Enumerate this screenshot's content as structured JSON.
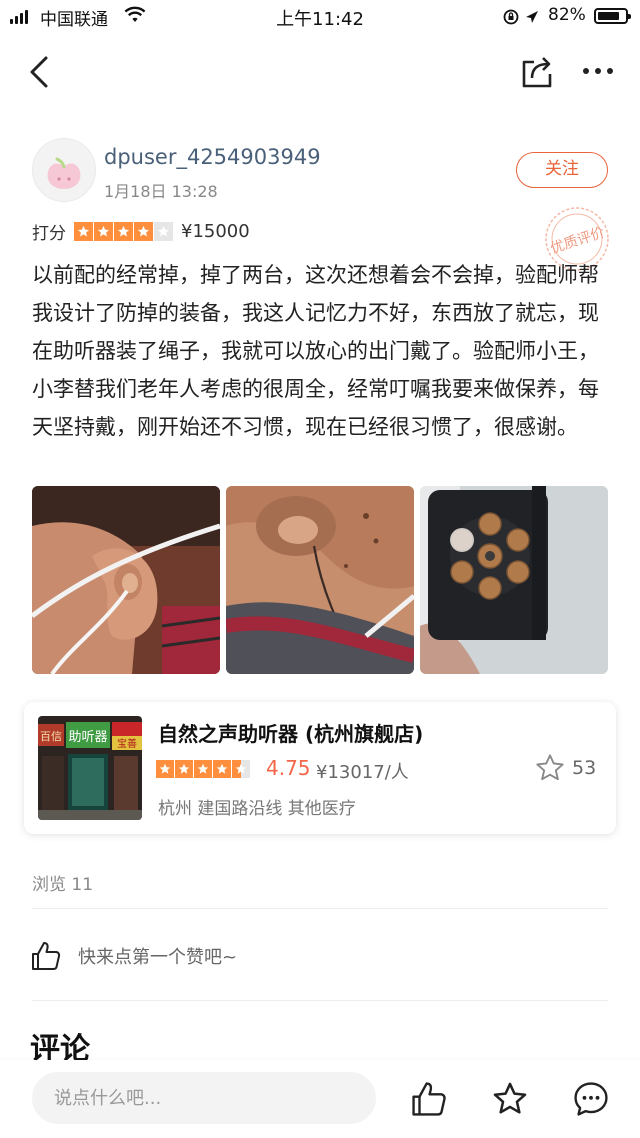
{
  "status_bar": {
    "carrier": "中国联通",
    "time": "上午11:42",
    "battery": "82%",
    "battery_level": 0.82
  },
  "nav": {
    "back_icon": "chevron-left-icon",
    "share_icon": "share-icon",
    "more_icon": "more-horizontal-icon"
  },
  "review": {
    "username": "dpuser_4254903949",
    "date": "1月18日  13:28",
    "follow_label": "关注",
    "badge_text": "优质评价",
    "rating_label": "打分",
    "rating_stars": 4,
    "rating_max": 5,
    "price": "¥15000",
    "text": "以前配的经常掉，掉了两台，这次还想着会不会掉，验配师帮我设计了防掉的装备，我这人记忆力不好，东西放了就忘，现在助听器装了绳子，我就可以放心的出门戴了。验配师小王，小李替我们老年人考虑的很周全，经常叮嘱我要来做保养，每天坚持戴，刚开始还不习惯，现在已经很习惯了，很感谢。"
  },
  "shop": {
    "name": "自然之声助听器 (杭州旗舰店)",
    "stars": 4.5,
    "score": "4.75",
    "avg_price": "¥13017/人",
    "area": "杭州  建国路沿线  其他医疗",
    "favorite_count": "53",
    "thumb_sign_main": "助听器",
    "thumb_sign_left": "百信",
    "thumb_sign_right": "宝善"
  },
  "stats": {
    "views": "浏览 11"
  },
  "like": {
    "hint": "快来点第一个赞吧~"
  },
  "comments": {
    "title": "评论"
  },
  "bottom_bar": {
    "input_placeholder": "说点什么吧..."
  },
  "colors": {
    "accent": "#e8643a",
    "star": "#ff8f3d",
    "score": "#f4664a",
    "username": "#4a6079"
  }
}
